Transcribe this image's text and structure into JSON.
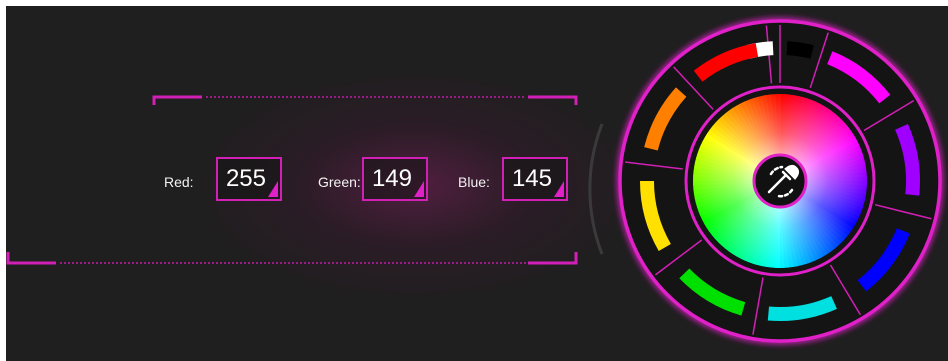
{
  "fields": [
    {
      "label": "Red:",
      "value": "255"
    },
    {
      "label": "Green:",
      "value": "149"
    },
    {
      "label": "Blue:",
      "value": "145"
    }
  ],
  "accent_color": "#d21fb6",
  "picker": {
    "center_icon": "eyedropper-icon",
    "swatches": [
      "#ffffff",
      "#000000",
      "#ff00ff",
      "#a000ff",
      "#0000ff",
      "#00e0e0",
      "#00e000",
      "#ffe000",
      "#ff8000",
      "#ff0000"
    ]
  }
}
